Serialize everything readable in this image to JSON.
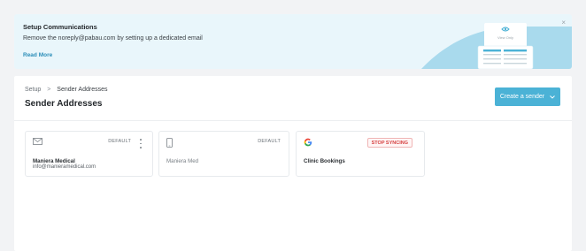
{
  "banner": {
    "title": "Setup Communications",
    "description": "Remove the noreply@pabau.com by setting up a dedicated email",
    "link_label": "Read More",
    "illustration_label": "View Only",
    "close_glyph": "×",
    "colors": {
      "background": "#e9f6fb",
      "wave": "#a9daed",
      "link": "#2a8db8"
    }
  },
  "breadcrumb": {
    "items": [
      "Setup",
      "Sender Addresses"
    ],
    "separator": ">"
  },
  "page": {
    "title": "Sender Addresses"
  },
  "create_button": {
    "label": "Create a sender",
    "icon": "chevron-down-icon",
    "color": "#4bb2d6"
  },
  "senders": [
    {
      "icon": "mail-icon",
      "badge": "DEFAULT",
      "name": "Maniera Medical",
      "email": "info@manieramedical.com",
      "has_menu": true
    },
    {
      "icon": "phone-icon",
      "badge": "DEFAULT",
      "name": "Maniera Med"
    },
    {
      "icon": "google-icon",
      "action": "STOP SYNCING",
      "name": "Clinic Bookings"
    }
  ]
}
